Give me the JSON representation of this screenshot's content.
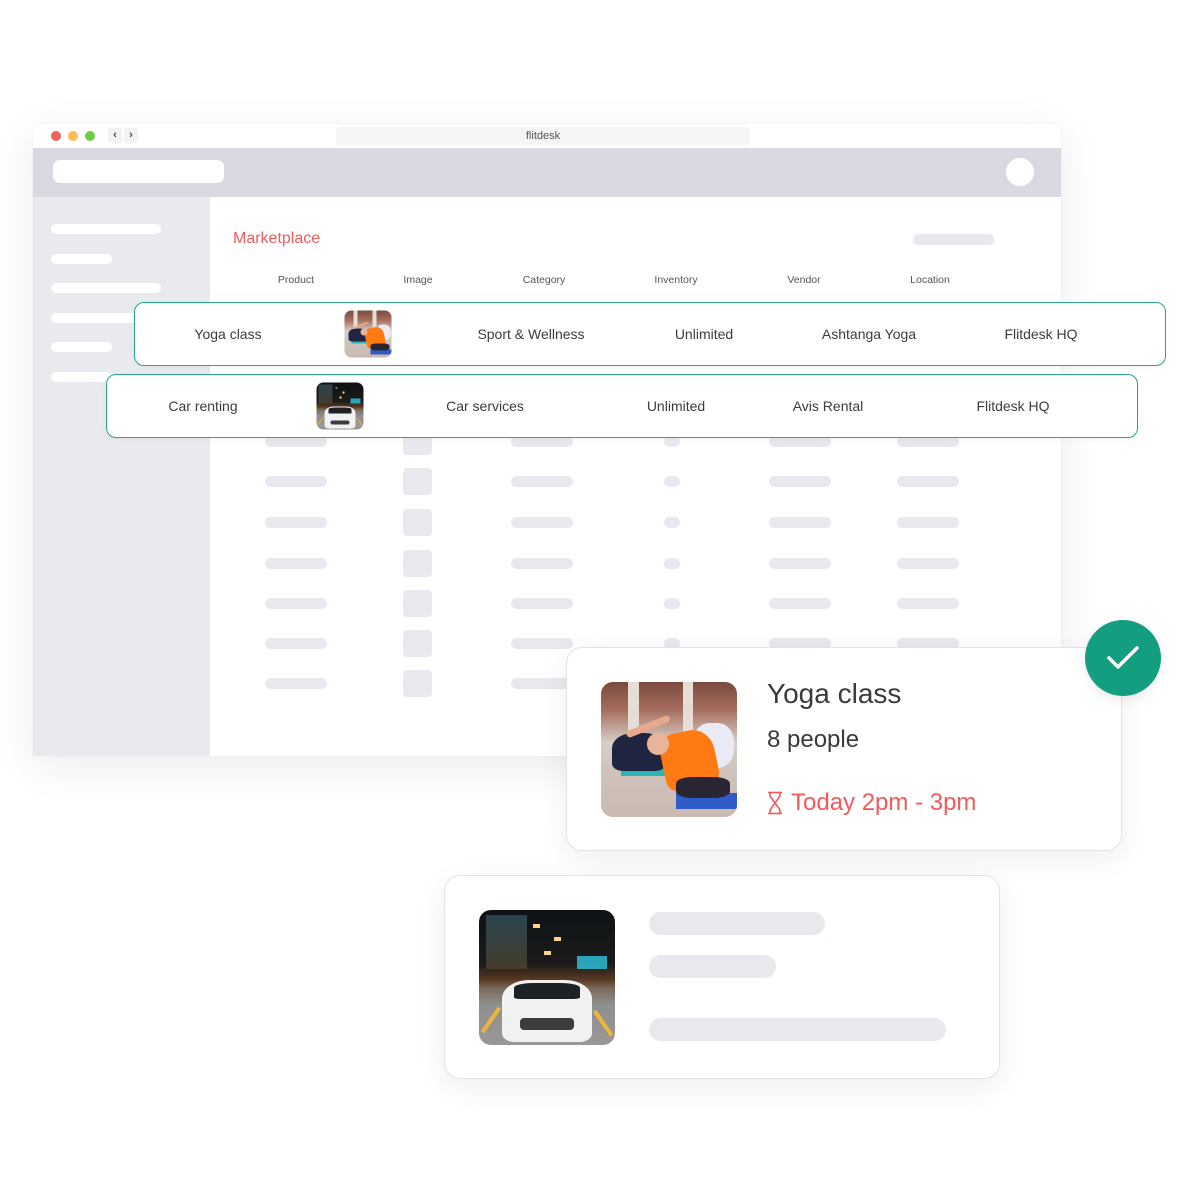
{
  "browser": {
    "url_title": "flitdesk",
    "back_label": "‹",
    "forward_label": "›"
  },
  "page": {
    "title": "Marketplace",
    "columns": [
      "Product",
      "Image",
      "Category",
      "Inventory",
      "Vendor",
      "Location"
    ]
  },
  "rows": [
    {
      "product": "Yoga class",
      "image": "yoga-class-photo",
      "category": "Sport & Wellness",
      "inventory": "Unlimited",
      "vendor": "Ashtanga Yoga",
      "location": "Flitdesk HQ"
    },
    {
      "product": "Car renting",
      "image": "car-photo",
      "category": "Car services",
      "inventory": "Unlimited",
      "vendor": "Avis Rental",
      "location": "Flitdesk HQ"
    }
  ],
  "booking_card": {
    "title": "Yoga class",
    "attendees": "8 people",
    "time": "Today 2pm - 3pm",
    "time_icon": "hourglass-icon",
    "status_icon": "check-icon",
    "status": "confirmed"
  },
  "colors": {
    "accent_red": "#f25a5a",
    "accent_green": "#149e80",
    "row_border": "#2aa58d",
    "skeleton": "#e8e9ee"
  }
}
